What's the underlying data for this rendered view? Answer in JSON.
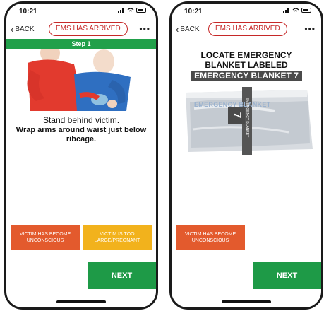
{
  "screen1": {
    "time": "10:21",
    "back_label": "BACK",
    "pill_label": "EMS HAS ARRIVED",
    "more_label": "•••",
    "step_label": "Step 1",
    "instruction_line1": "Stand behind victim.",
    "instruction_line2": "Wrap arms around waist just below ribcage.",
    "btn_unconscious": "VICTIM HAS BECOME UNCONSCIOUS",
    "btn_too_large": "VICTIM IS TOO LARGE/PREGNANT",
    "next_label": "NEXT"
  },
  "screen2": {
    "time": "10:21",
    "back_label": "BACK",
    "pill_label": "EMS HAS ARRIVED",
    "more_label": "•••",
    "title_line1": "LOCATE EMERGENCY",
    "title_line2": "BLANKET LABELED",
    "title_tag": "EMERGENCY BLANKET 7",
    "blanket_print": "EMERGENCY BLANKET",
    "blanket_number": "7",
    "blanket_strap_text": "EMERGENCY BLANKET",
    "btn_unconscious": "VICTIM HAS BECOME UNCONSCIOUS",
    "next_label": "NEXT"
  },
  "colors": {
    "pill_red": "#c62828",
    "step_green": "#21a04a",
    "next_green": "#1e9a47",
    "btn_red": "#e35a2d",
    "btn_amber": "#f2b21c"
  }
}
